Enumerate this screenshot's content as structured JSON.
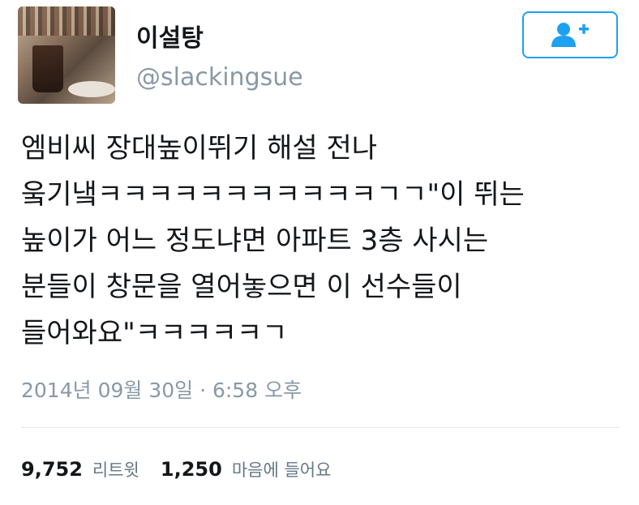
{
  "profile": {
    "display_name": "이설탕",
    "handle": "@slackingsue"
  },
  "follow_button": {
    "icon": "add-user-icon",
    "color": "#1da1f2"
  },
  "tweet": {
    "text": "엠비씨 장대높이뛰기 해설 전나\n웈기냌ㅋㅋㅋㅋㅋㅋㅋㅋㅋㅋㅋㄱㄱ\"이 뛰는\n높이가 어느 정도냐면 아파트 3층 사시는\n분들이 창문을 열어놓으면 이 선수들이\n들어와요\"ㅋㅋㅋㅋㅋㄱ",
    "timestamp": "2014년 09월 30일 · 6:58 오후"
  },
  "stats": {
    "retweets_count": "9,752",
    "retweets_label": "리트윗",
    "likes_count": "1,250",
    "likes_label": "마음에 들어요"
  }
}
